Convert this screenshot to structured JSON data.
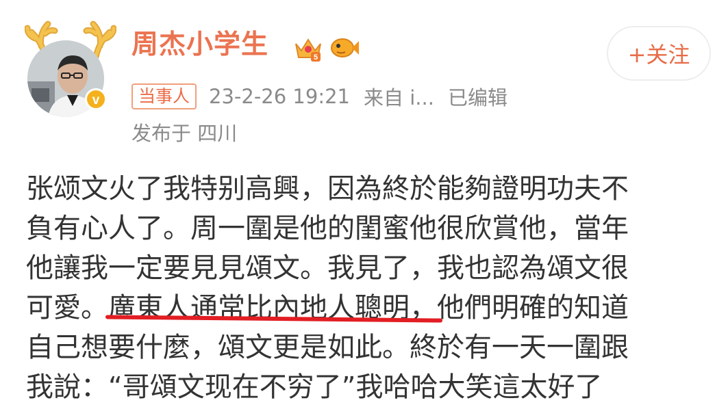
{
  "post": {
    "author": {
      "name": "周杰小学生",
      "avatar": "avatar-with-reindeer-antlers",
      "verified_badge": "verified-icon"
    },
    "badges": [
      "crown-icon",
      "fish-icon"
    ],
    "follow_label": "+关注",
    "meta": {
      "tag": "当事人",
      "timestamp": "23-2-26 19:21",
      "source": "来自 i...",
      "edited": "已编辑",
      "location": "发布于 四川"
    },
    "content": {
      "line1": "张颂文火了我特别高興，因為終於能夠證明功夫不",
      "line2": "負有心人了。周一圍是他的閨蜜他很欣賞他，當年",
      "line3": "他讓我一定要見見頌文。我見了，我也認為頌文很",
      "line4_before": "可愛。",
      "line4_highlight": "廣東人通常比內地人聰明，",
      "line4_after": "他們明確的知道",
      "line5": "自己想要什麼，頌文更是如此。終於有一天一圍跟",
      "line6": "我說：“哥頌文现在不穷了”我哈哈大笑這太好了"
    },
    "colors": {
      "username": "#eb7350",
      "badge_border": "#f0a07c",
      "meta_gray": "#8a8a8a",
      "underline": "#e21e24",
      "body_text": "#333333"
    }
  }
}
